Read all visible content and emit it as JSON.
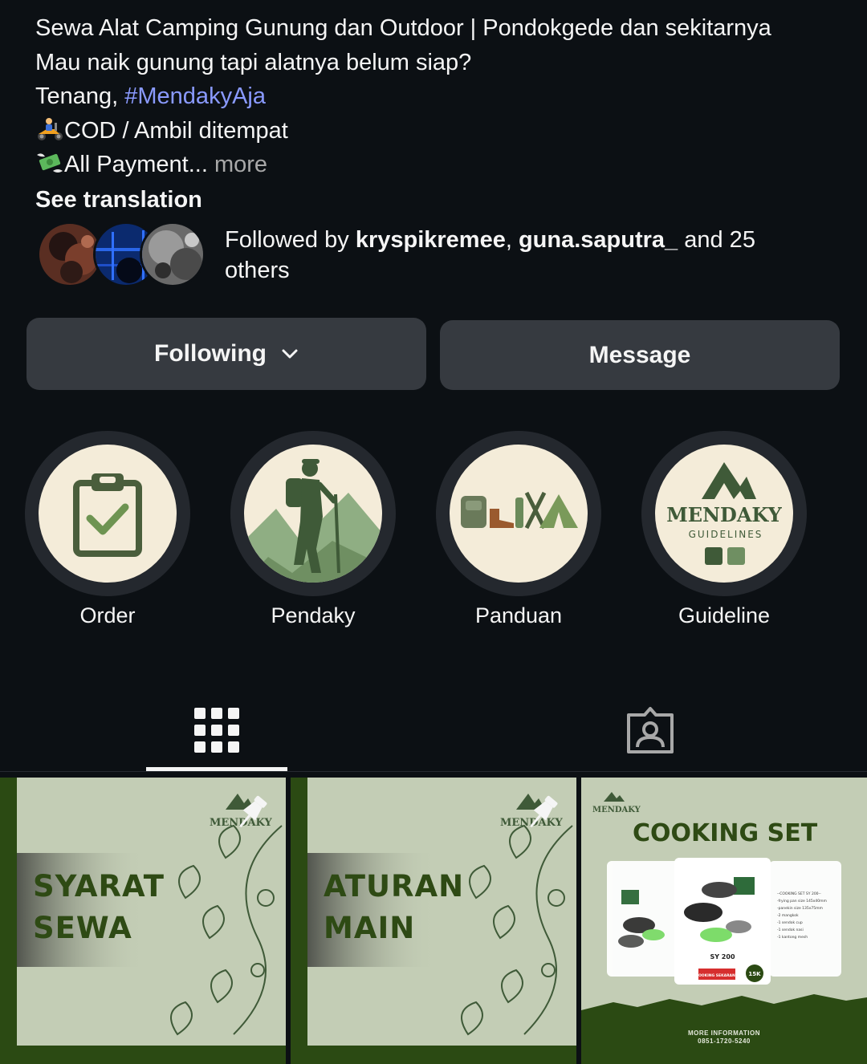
{
  "bio": {
    "title": "Sewa Alat Camping Gunung dan Outdoor | Pondokgede dan sekitarnya",
    "line2": "Mau naik gunung tapi alatnya belum siap?",
    "line3_prefix": "Tenang, ",
    "hashtag": "#MendakyAja",
    "line4": "COD / Ambil ditempat",
    "line5": "All Payment...",
    "more": " more",
    "see_translation": "See translation"
  },
  "followed": {
    "prefix": "Followed by ",
    "user1": "kryspikremee",
    "separator": ", ",
    "user2": "guna.saputra_",
    "suffix": " and 25 others"
  },
  "buttons": {
    "following": "Following",
    "message": "Message"
  },
  "highlights": [
    {
      "label": "Order",
      "icon": "clipboard-check-icon"
    },
    {
      "label": "Pendaky",
      "icon": "hiker-icon"
    },
    {
      "label": "Panduan",
      "icon": "camping-gear-icon"
    },
    {
      "label": "Guideline",
      "icon": "mendaky-logo-icon",
      "logo_text": "MENDAKY",
      "logo_sub": "GUIDELINES"
    }
  ],
  "tabs": [
    {
      "name": "posts-grid",
      "icon": "grid-icon",
      "active": true
    },
    {
      "name": "tagged",
      "icon": "tagged-person-icon",
      "active": false
    }
  ],
  "posts": [
    {
      "title_line1": "SYARAT",
      "title_line2": "SEWA",
      "brand": "MENDAKY",
      "pinned": true
    },
    {
      "title_line1": "ATURAN",
      "title_line2": "MAIN",
      "brand": "MENDAKY",
      "pinned": true
    },
    {
      "title": "COOKING SET",
      "brand": "MENDAKY",
      "product": "SY 200",
      "price": "15K",
      "badge": "BOOKING SEKARANG",
      "info_title": "MORE INFORMATION",
      "info_phone": "0851-1720-5240",
      "spec_lines": [
        "--COOKING SET SY 200--",
        "-frying pan size 145x40mm",
        "-panekin size 135x75mm",
        "-2 mangkok",
        "-1 sendok cup",
        "-1 sendok nasi",
        "-1 kantong mesh"
      ]
    }
  ],
  "colors": {
    "background": "#0c1014",
    "button": "#363a40",
    "hashtag": "#8a9aff",
    "post_green": "#2b4a13",
    "post_sage": "#c3cdb5"
  }
}
